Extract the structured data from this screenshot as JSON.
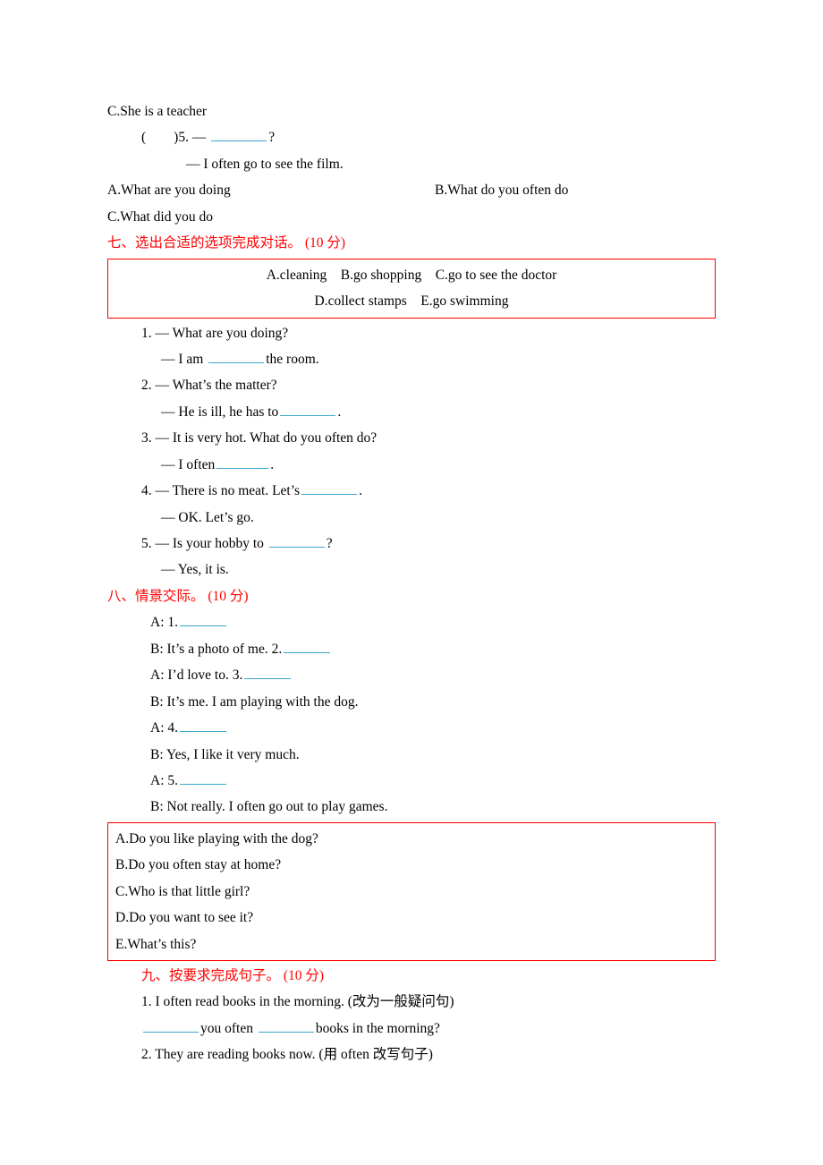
{
  "topC": "C.She is a teacher",
  "q5num": "(　　)5. — ",
  "q5tail": "?",
  "q5line2": "— I often go to see the film.",
  "q5A": "A.What are you doing",
  "q5B": "B.What do you often do",
  "q5C": "C.What did you do",
  "heading7": "七、选出合适的选项完成对话。 (10 分)",
  "box7l1": "A.cleaning　B.go shopping　C.go to see the doctor",
  "box7l2": "D.collect stamps　E.go swimming",
  "s7_1a": "1. — What are you doing?",
  "s7_1b_pre": "— I am ",
  "s7_1b_post": "the room.",
  "s7_2a": "2. — What’s the matter?",
  "s7_2b_pre": "— He is ill, he has to",
  "s7_2b_post": ".",
  "s7_3a": "3. — It is very hot. What do you often do?",
  "s7_3b_pre": "— I often",
  "s7_3b_post": ".",
  "s7_4a_pre": "4. — There is no meat. Let’s",
  "s7_4a_post": ".",
  "s7_4b": "— OK. Let’s go.",
  "s7_5a_pre": "5. — Is your hobby to ",
  "s7_5a_post": "?",
  "s7_5b": "— Yes, it is.",
  "heading8": "八、情景交际。 (10 分)",
  "s8_A1": "A: 1.",
  "s8_B1": "B: It’s a photo of me. 2.",
  "s8_A2": "A: I’d love to. 3.",
  "s8_B2": "B: It’s me. I am playing with the dog.",
  "s8_A3": "A: 4.",
  "s8_B3": "B: Yes, I like it very much.",
  "s8_A4": "A: 5.",
  "s8_B4": "B: Not really. I often go out to play games.",
  "box8A": "A.Do you like playing with the dog?",
  "box8B": "B.Do you often stay at home?",
  "box8C": "C.Who is that little girl?",
  "box8D": "D.Do you want to see it?",
  "box8E": "E.What’s this?",
  "heading9": "九、按要求完成句子。 (10 分)",
  "s9_1": "1. I often read books in the morning. (改为一般疑问句)",
  "s9_1f_mid": "you often ",
  "s9_1f_post": "books in the morning?",
  "s9_2": "2. They are reading books now. (用 often 改写句子)"
}
